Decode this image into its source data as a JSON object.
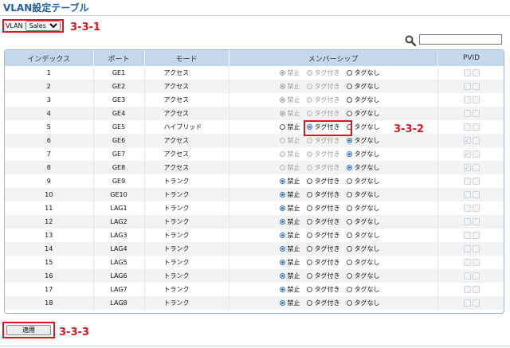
{
  "page_title": "VLAN設定テーブル",
  "vlan_label": "VLAN",
  "vlan_selected": "Sales",
  "annotations": {
    "vlan": "3-3-1",
    "member": "3-3-2",
    "apply": "3-3-3"
  },
  "search_placeholder": "",
  "columns": [
    "インデックス",
    "ポート",
    "モード",
    "メンバーシップ",
    "PVID"
  ],
  "membership_options": [
    "禁止",
    "タグ付き",
    "タグなし"
  ],
  "apply_label": "適用",
  "colors": {
    "accent": "#1f5fa8",
    "annotation_red": "#e0141e",
    "header_bg": "#c4d7ec"
  },
  "rows": [
    {
      "index": "1",
      "port": "GE1",
      "mode": "アクセス",
      "selected": 0,
      "forbid_disabled": true,
      "tagged_disabled": true,
      "pvid_checked": false
    },
    {
      "index": "2",
      "port": "GE2",
      "mode": "アクセス",
      "selected": 0,
      "forbid_disabled": true,
      "tagged_disabled": true,
      "pvid_checked": false
    },
    {
      "index": "3",
      "port": "GE3",
      "mode": "アクセス",
      "selected": 0,
      "forbid_disabled": true,
      "tagged_disabled": true,
      "pvid_checked": false
    },
    {
      "index": "4",
      "port": "GE4",
      "mode": "アクセス",
      "selected": 0,
      "forbid_disabled": true,
      "tagged_disabled": true,
      "pvid_checked": false
    },
    {
      "index": "5",
      "port": "GE5",
      "mode": "ハイブリッド",
      "selected": 1,
      "forbid_disabled": false,
      "tagged_disabled": false,
      "pvid_checked": false
    },
    {
      "index": "6",
      "port": "GE6",
      "mode": "アクセス",
      "selected": 2,
      "forbid_disabled": true,
      "tagged_disabled": true,
      "pvid_checked": true
    },
    {
      "index": "7",
      "port": "GE7",
      "mode": "アクセス",
      "selected": 2,
      "forbid_disabled": true,
      "tagged_disabled": true,
      "pvid_checked": true
    },
    {
      "index": "8",
      "port": "GE8",
      "mode": "アクセス",
      "selected": 2,
      "forbid_disabled": true,
      "tagged_disabled": true,
      "pvid_checked": true
    },
    {
      "index": "9",
      "port": "GE9",
      "mode": "トランク",
      "selected": 0,
      "forbid_disabled": false,
      "tagged_disabled": false,
      "pvid_checked": false
    },
    {
      "index": "10",
      "port": "GE10",
      "mode": "トランク",
      "selected": 0,
      "forbid_disabled": false,
      "tagged_disabled": false,
      "pvid_checked": false
    },
    {
      "index": "11",
      "port": "LAG1",
      "mode": "トランク",
      "selected": 0,
      "forbid_disabled": false,
      "tagged_disabled": false,
      "pvid_checked": false
    },
    {
      "index": "12",
      "port": "LAG2",
      "mode": "トランク",
      "selected": 0,
      "forbid_disabled": false,
      "tagged_disabled": false,
      "pvid_checked": false
    },
    {
      "index": "13",
      "port": "LAG3",
      "mode": "トランク",
      "selected": 0,
      "forbid_disabled": false,
      "tagged_disabled": false,
      "pvid_checked": false
    },
    {
      "index": "14",
      "port": "LAG4",
      "mode": "トランク",
      "selected": 0,
      "forbid_disabled": false,
      "tagged_disabled": false,
      "pvid_checked": false
    },
    {
      "index": "15",
      "port": "LAG5",
      "mode": "トランク",
      "selected": 0,
      "forbid_disabled": false,
      "tagged_disabled": false,
      "pvid_checked": false
    },
    {
      "index": "16",
      "port": "LAG6",
      "mode": "トランク",
      "selected": 0,
      "forbid_disabled": false,
      "tagged_disabled": false,
      "pvid_checked": false
    },
    {
      "index": "17",
      "port": "LAG7",
      "mode": "トランク",
      "selected": 0,
      "forbid_disabled": false,
      "tagged_disabled": false,
      "pvid_checked": false
    },
    {
      "index": "18",
      "port": "LAG8",
      "mode": "トランク",
      "selected": 0,
      "forbid_disabled": false,
      "tagged_disabled": false,
      "pvid_checked": false
    }
  ]
}
